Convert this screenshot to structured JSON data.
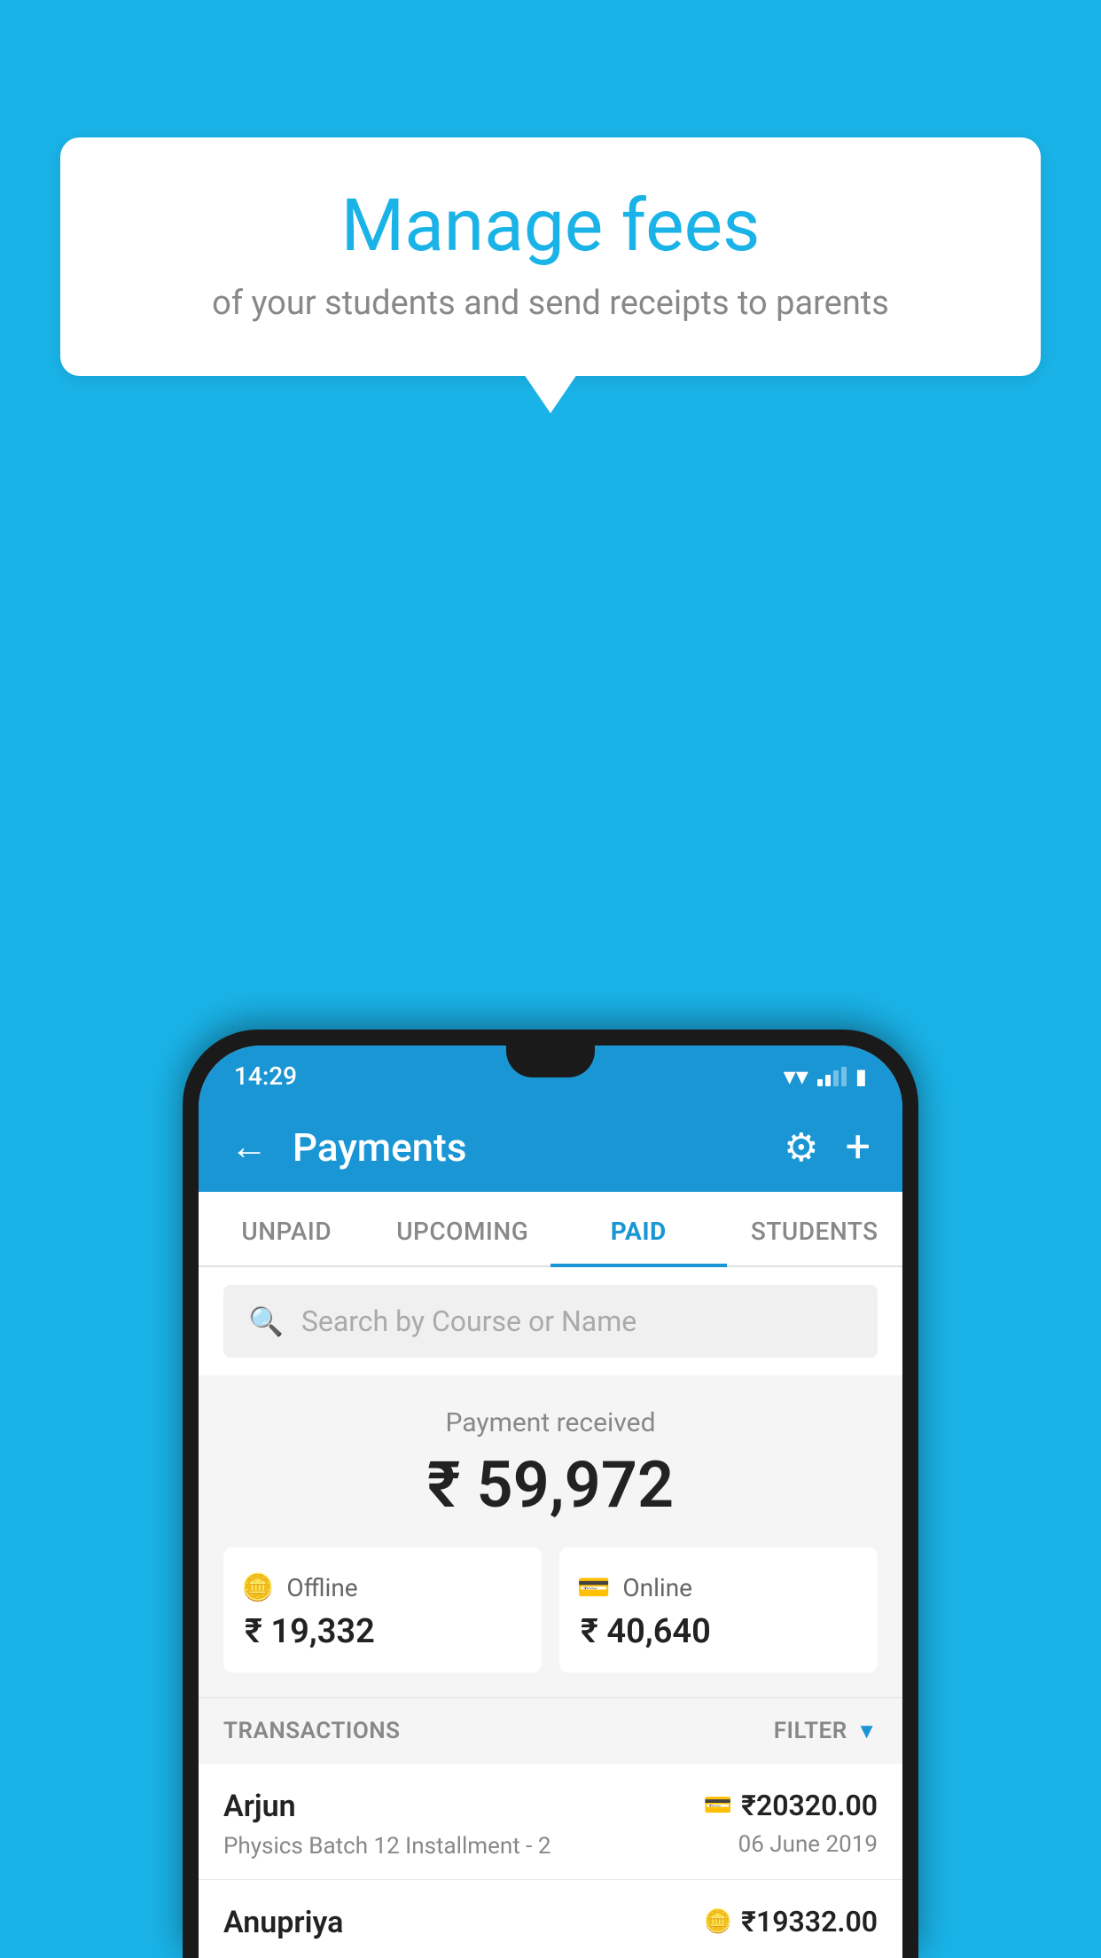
{
  "background_color": "#1ab3e8",
  "bubble": {
    "title": "Manage fees",
    "subtitle": "of your students and send receipts to parents"
  },
  "status_bar": {
    "time": "14:29",
    "wifi": "▾",
    "battery": "▮"
  },
  "app_bar": {
    "title": "Payments",
    "back_label": "←",
    "gear_label": "⚙",
    "plus_label": "+"
  },
  "tabs": [
    {
      "label": "UNPAID",
      "active": false
    },
    {
      "label": "UPCOMING",
      "active": false
    },
    {
      "label": "PAID",
      "active": true
    },
    {
      "label": "STUDENTS",
      "active": false
    }
  ],
  "search": {
    "placeholder": "Search by Course or Name"
  },
  "payment_summary": {
    "label": "Payment received",
    "amount": "₹ 59,972",
    "offline": {
      "icon": "offline",
      "type": "Offline",
      "amount": "₹ 19,332"
    },
    "online": {
      "icon": "online",
      "type": "Online",
      "amount": "₹ 40,640"
    }
  },
  "transactions": {
    "label": "TRANSACTIONS",
    "filter_label": "FILTER",
    "rows": [
      {
        "name": "Arjun",
        "detail": "Physics Batch 12 Installment - 2",
        "amount": "₹20320.00",
        "date": "06 June 2019",
        "payment_type": "online"
      },
      {
        "name": "Anupriya",
        "detail": "",
        "amount": "₹19332.00",
        "date": "",
        "payment_type": "offline"
      }
    ]
  }
}
